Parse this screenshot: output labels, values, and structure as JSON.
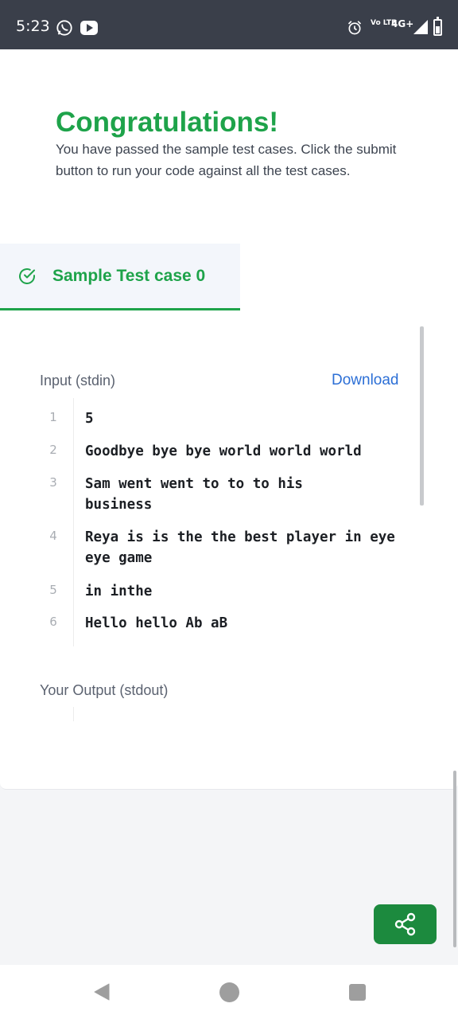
{
  "status_bar": {
    "time": "5:23",
    "icons": [
      "whatsapp-icon",
      "youtube-icon",
      "alarm-icon",
      "signal-icon",
      "battery-icon"
    ],
    "volte": "Vo LTE",
    "network": "4G+"
  },
  "banner": {
    "title": "Congratulations!",
    "message": "You have passed the sample test cases. Click the submit button to run your code against all the test cases."
  },
  "tab": {
    "label": "Sample Test case 0",
    "icon": "check-circle-icon"
  },
  "input": {
    "label": "Input (stdin)",
    "download_label": "Download",
    "lines": [
      {
        "num": "1",
        "text": "5"
      },
      {
        "num": "2",
        "text": "Goodbye bye bye world world world"
      },
      {
        "num": "3",
        "text": "Sam went went to to to his business"
      },
      {
        "num": "4",
        "text": "Reya is is the the best player in eye eye game"
      },
      {
        "num": "5",
        "text": "in inthe"
      },
      {
        "num": "6",
        "text": "Hello hello Ab aB"
      }
    ]
  },
  "output": {
    "label": "Your Output (stdout)"
  },
  "share": {
    "icon": "share-icon"
  },
  "colors": {
    "accent_green": "#1ea34a",
    "link_blue": "#2c6fd6",
    "status_bar": "#3a3f4a"
  }
}
